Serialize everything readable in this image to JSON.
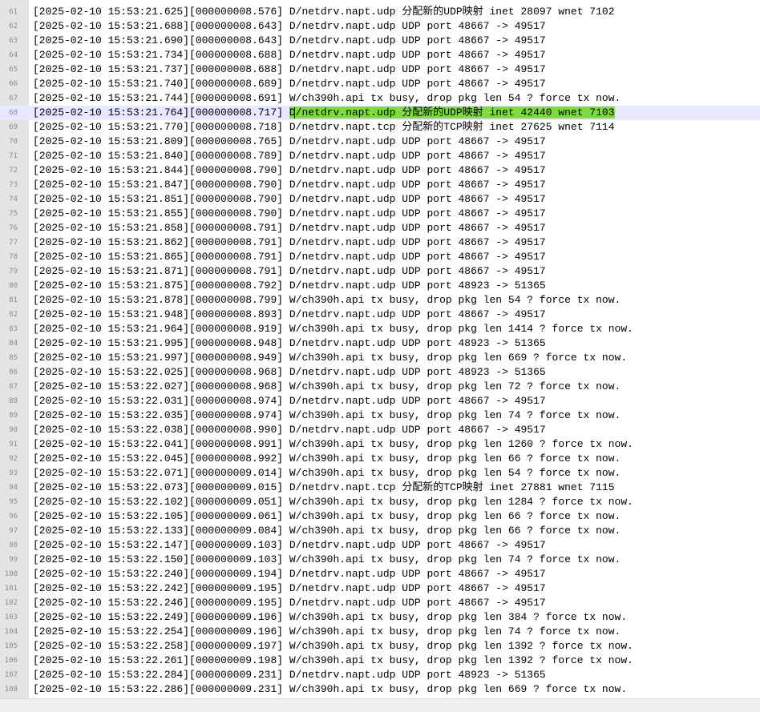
{
  "editor": {
    "current_line": 68,
    "highlight_color": "#7cdd3b",
    "current_line_color": "#e8e8ff",
    "lines": [
      {
        "num": "61",
        "ts": "[2025-02-10 15:53:21.625][000000008.576] ",
        "text": "D/netdrv.napt.udp 分配新的UDP映射 inet 28097 wnet 7102"
      },
      {
        "num": "62",
        "ts": "[2025-02-10 15:53:21.688][000000008.643] ",
        "text": "D/netdrv.napt.udp UDP port 48667 -> 49517"
      },
      {
        "num": "63",
        "ts": "[2025-02-10 15:53:21.690][000000008.643] ",
        "text": "D/netdrv.napt.udp UDP port 48667 -> 49517"
      },
      {
        "num": "64",
        "ts": "[2025-02-10 15:53:21.734][000000008.688] ",
        "text": "D/netdrv.napt.udp UDP port 48667 -> 49517"
      },
      {
        "num": "65",
        "ts": "[2025-02-10 15:53:21.737][000000008.688] ",
        "text": "D/netdrv.napt.udp UDP port 48667 -> 49517"
      },
      {
        "num": "66",
        "ts": "[2025-02-10 15:53:21.740][000000008.689] ",
        "text": "D/netdrv.napt.udp UDP port 48667 -> 49517"
      },
      {
        "num": "67",
        "ts": "[2025-02-10 15:53:21.744][000000008.691] ",
        "text": "W/ch390h.api tx busy, drop pkg len 54 ? force tx now."
      },
      {
        "num": "68",
        "ts": "[2025-02-10 15:53:21.764][000000008.717] ",
        "text": "D/netdrv.napt.udp 分配新的UDP映射 inet 42440 wnet 7103"
      },
      {
        "num": "69",
        "ts": "[2025-02-10 15:53:21.770][000000008.718] ",
        "text": "D/netdrv.napt.tcp 分配新的TCP映射 inet 27625 wnet 7114"
      },
      {
        "num": "70",
        "ts": "[2025-02-10 15:53:21.809][000000008.765] ",
        "text": "D/netdrv.napt.udp UDP port 48667 -> 49517"
      },
      {
        "num": "71",
        "ts": "[2025-02-10 15:53:21.840][000000008.789] ",
        "text": "D/netdrv.napt.udp UDP port 48667 -> 49517"
      },
      {
        "num": "72",
        "ts": "[2025-02-10 15:53:21.844][000000008.790] ",
        "text": "D/netdrv.napt.udp UDP port 48667 -> 49517"
      },
      {
        "num": "73",
        "ts": "[2025-02-10 15:53:21.847][000000008.790] ",
        "text": "D/netdrv.napt.udp UDP port 48667 -> 49517"
      },
      {
        "num": "74",
        "ts": "[2025-02-10 15:53:21.851][000000008.790] ",
        "text": "D/netdrv.napt.udp UDP port 48667 -> 49517"
      },
      {
        "num": "75",
        "ts": "[2025-02-10 15:53:21.855][000000008.790] ",
        "text": "D/netdrv.napt.udp UDP port 48667 -> 49517"
      },
      {
        "num": "76",
        "ts": "[2025-02-10 15:53:21.858][000000008.791] ",
        "text": "D/netdrv.napt.udp UDP port 48667 -> 49517"
      },
      {
        "num": "77",
        "ts": "[2025-02-10 15:53:21.862][000000008.791] ",
        "text": "D/netdrv.napt.udp UDP port 48667 -> 49517"
      },
      {
        "num": "78",
        "ts": "[2025-02-10 15:53:21.865][000000008.791] ",
        "text": "D/netdrv.napt.udp UDP port 48667 -> 49517"
      },
      {
        "num": "79",
        "ts": "[2025-02-10 15:53:21.871][000000008.791] ",
        "text": "D/netdrv.napt.udp UDP port 48667 -> 49517"
      },
      {
        "num": "80",
        "ts": "[2025-02-10 15:53:21.875][000000008.792] ",
        "text": "D/netdrv.napt.udp UDP port 48923 -> 51365"
      },
      {
        "num": "81",
        "ts": "[2025-02-10 15:53:21.878][000000008.799] ",
        "text": "W/ch390h.api tx busy, drop pkg len 54 ? force tx now."
      },
      {
        "num": "82",
        "ts": "[2025-02-10 15:53:21.948][000000008.893] ",
        "text": "D/netdrv.napt.udp UDP port 48667 -> 49517"
      },
      {
        "num": "83",
        "ts": "[2025-02-10 15:53:21.964][000000008.919] ",
        "text": "W/ch390h.api tx busy, drop pkg len 1414 ? force tx now."
      },
      {
        "num": "84",
        "ts": "[2025-02-10 15:53:21.995][000000008.948] ",
        "text": "D/netdrv.napt.udp UDP port 48923 -> 51365"
      },
      {
        "num": "85",
        "ts": "[2025-02-10 15:53:21.997][000000008.949] ",
        "text": "W/ch390h.api tx busy, drop pkg len 669 ? force tx now."
      },
      {
        "num": "86",
        "ts": "[2025-02-10 15:53:22.025][000000008.968] ",
        "text": "D/netdrv.napt.udp UDP port 48923 -> 51365"
      },
      {
        "num": "87",
        "ts": "[2025-02-10 15:53:22.027][000000008.968] ",
        "text": "W/ch390h.api tx busy, drop pkg len 72 ? force tx now."
      },
      {
        "num": "88",
        "ts": "[2025-02-10 15:53:22.031][000000008.974] ",
        "text": "D/netdrv.napt.udp UDP port 48667 -> 49517"
      },
      {
        "num": "89",
        "ts": "[2025-02-10 15:53:22.035][000000008.974] ",
        "text": "W/ch390h.api tx busy, drop pkg len 74 ? force tx now."
      },
      {
        "num": "90",
        "ts": "[2025-02-10 15:53:22.038][000000008.990] ",
        "text": "D/netdrv.napt.udp UDP port 48667 -> 49517"
      },
      {
        "num": "91",
        "ts": "[2025-02-10 15:53:22.041][000000008.991] ",
        "text": "W/ch390h.api tx busy, drop pkg len 1260 ? force tx now."
      },
      {
        "num": "92",
        "ts": "[2025-02-10 15:53:22.045][000000008.992] ",
        "text": "W/ch390h.api tx busy, drop pkg len 66 ? force tx now."
      },
      {
        "num": "93",
        "ts": "[2025-02-10 15:53:22.071][000000009.014] ",
        "text": "W/ch390h.api tx busy, drop pkg len 54 ? force tx now."
      },
      {
        "num": "94",
        "ts": "[2025-02-10 15:53:22.073][000000009.015] ",
        "text": "D/netdrv.napt.tcp 分配新的TCP映射 inet 27881 wnet 7115"
      },
      {
        "num": "95",
        "ts": "[2025-02-10 15:53:22.102][000000009.051] ",
        "text": "W/ch390h.api tx busy, drop pkg len 1284 ? force tx now."
      },
      {
        "num": "96",
        "ts": "[2025-02-10 15:53:22.105][000000009.061] ",
        "text": "W/ch390h.api tx busy, drop pkg len 66 ? force tx now."
      },
      {
        "num": "97",
        "ts": "[2025-02-10 15:53:22.133][000000009.084] ",
        "text": "W/ch390h.api tx busy, drop pkg len 66 ? force tx now."
      },
      {
        "num": "98",
        "ts": "[2025-02-10 15:53:22.147][000000009.103] ",
        "text": "D/netdrv.napt.udp UDP port 48667 -> 49517"
      },
      {
        "num": "99",
        "ts": "[2025-02-10 15:53:22.150][000000009.103] ",
        "text": "W/ch390h.api tx busy, drop pkg len 74 ? force tx now."
      },
      {
        "num": "100",
        "ts": "[2025-02-10 15:53:22.240][000000009.194] ",
        "text": "D/netdrv.napt.udp UDP port 48667 -> 49517"
      },
      {
        "num": "101",
        "ts": "[2025-02-10 15:53:22.242][000000009.195] ",
        "text": "D/netdrv.napt.udp UDP port 48667 -> 49517"
      },
      {
        "num": "102",
        "ts": "[2025-02-10 15:53:22.246][000000009.195] ",
        "text": "D/netdrv.napt.udp UDP port 48667 -> 49517"
      },
      {
        "num": "103",
        "ts": "[2025-02-10 15:53:22.249][000000009.196] ",
        "text": "W/ch390h.api tx busy, drop pkg len 384 ? force tx now."
      },
      {
        "num": "104",
        "ts": "[2025-02-10 15:53:22.254][000000009.196] ",
        "text": "W/ch390h.api tx busy, drop pkg len 74 ? force tx now."
      },
      {
        "num": "105",
        "ts": "[2025-02-10 15:53:22.258][000000009.197] ",
        "text": "W/ch390h.api tx busy, drop pkg len 1392 ? force tx now."
      },
      {
        "num": "106",
        "ts": "[2025-02-10 15:53:22.261][000000009.198] ",
        "text": "W/ch390h.api tx busy, drop pkg len 1392 ? force tx now."
      },
      {
        "num": "107",
        "ts": "[2025-02-10 15:53:22.284][000000009.231] ",
        "text": "D/netdrv.napt.udp UDP port 48923 -> 51365"
      },
      {
        "num": "108",
        "ts": "[2025-02-10 15:53:22.286][000000009.231] ",
        "text": "W/ch390h.api tx busy, drop pkg len 669 ? force tx now."
      }
    ]
  }
}
